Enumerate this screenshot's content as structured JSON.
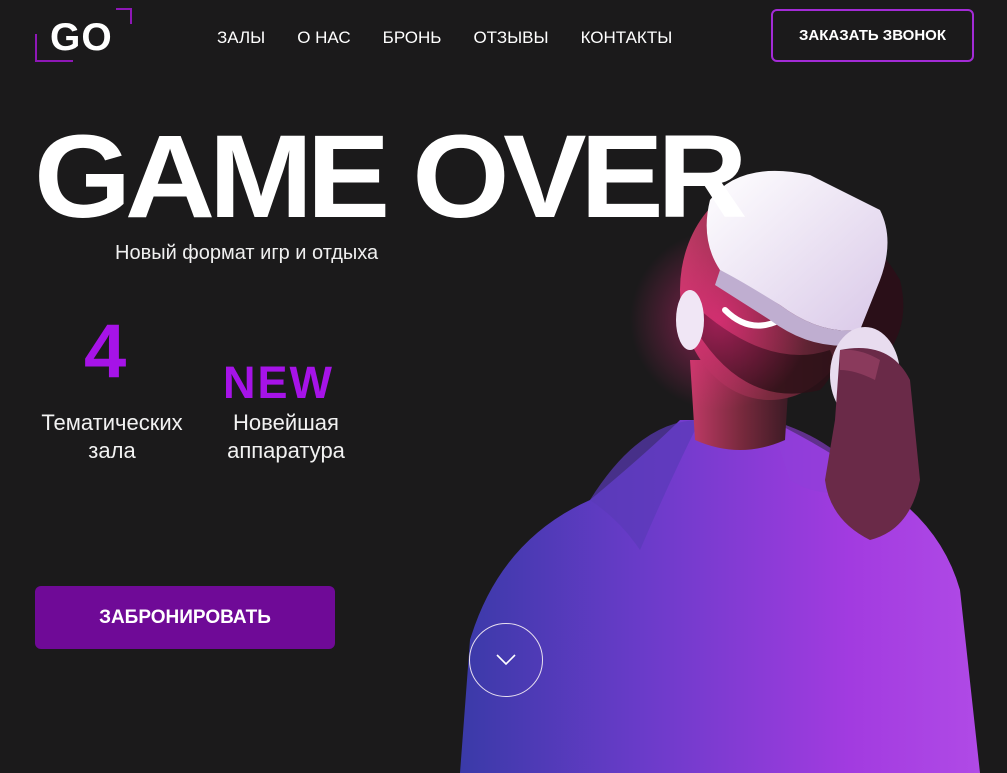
{
  "logo": {
    "text": "GO"
  },
  "nav": {
    "items": [
      "ЗАЛЫ",
      "О НАС",
      "БРОНЬ",
      "ОТЗЫВЫ",
      "КОНТАКТЫ"
    ]
  },
  "header": {
    "call_button_label": "ЗАКАЗАТЬ ЗВОНОК"
  },
  "hero": {
    "title": "GAME OVER",
    "subtitle": "Новый формат игр и отдыха",
    "stats": [
      {
        "value": "4",
        "label": "Тематических зала"
      },
      {
        "value": "NEW",
        "label": "Новейшая аппаратура"
      }
    ],
    "book_button_label": "ЗАБРОНИРОВАТЬ",
    "scroll_icon": "chevron-down-icon"
  },
  "colors": {
    "background": "#1b1a1b",
    "accent": "#a613e8",
    "button": "#6f0a97",
    "outline": "#a32bd6"
  }
}
